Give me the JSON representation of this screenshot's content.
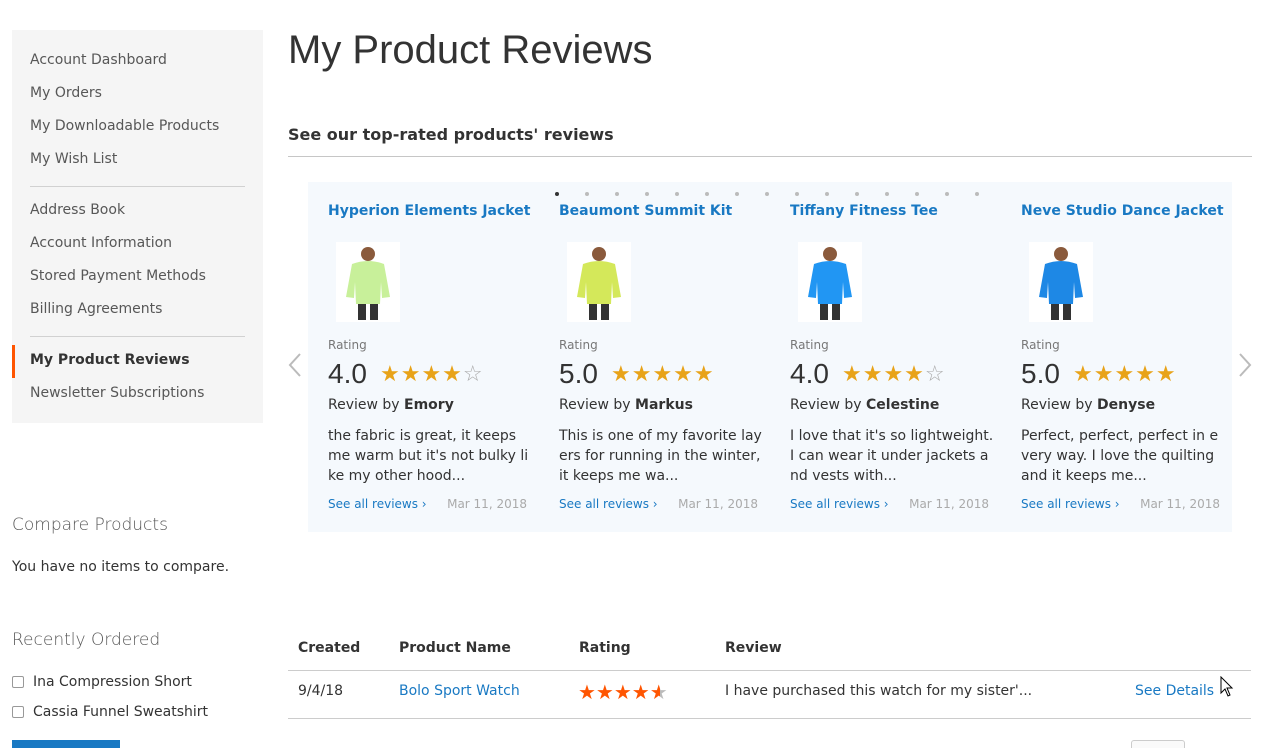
{
  "sidebar": {
    "group1": [
      "Account Dashboard",
      "My Orders",
      "My Downloadable Products",
      "My Wish List"
    ],
    "group2": [
      "Address Book",
      "Account Information",
      "Stored Payment Methods",
      "Billing Agreements"
    ],
    "group3": [
      "My Product Reviews",
      "Newsletter Subscriptions"
    ],
    "active": "My Product Reviews"
  },
  "compare": {
    "title": "Compare Products",
    "empty": "You have no items to compare."
  },
  "recently_ordered": {
    "title": "Recently Ordered",
    "items": [
      "Ina Compression Short",
      "Cassia Funnel Sweatshirt"
    ]
  },
  "page": {
    "title": "My Product Reviews"
  },
  "carousel": {
    "title": "See our top-rated products' reviews",
    "dots_count": 15,
    "active_dot": 0,
    "cards": [
      {
        "product": "Hyperion Elements Jacket",
        "rating_label": "Rating",
        "score": "4.0",
        "stars": 4,
        "by_prefix": "Review by",
        "author": "Emory",
        "text": "the fabric is great, it keeps me warm but it's not bulky like my other hood...",
        "see_all": "See all reviews ›",
        "date": "Mar 11, 2018",
        "shirt_color": "#c8f09a"
      },
      {
        "product": "Beaumont Summit Kit",
        "rating_label": "Rating",
        "score": "5.0",
        "stars": 5,
        "by_prefix": "Review by",
        "author": "Markus",
        "text": "This is one of my favorite layers for running in the winter, it keeps me wa...",
        "see_all": "See all reviews ›",
        "date": "Mar 11, 2018",
        "shirt_color": "#d4e85a"
      },
      {
        "product": "Tiffany Fitness Tee",
        "rating_label": "Rating",
        "score": "4.0",
        "stars": 4,
        "by_prefix": "Review by",
        "author": "Celestine",
        "text": "I love that it's so lightweight. I can wear it under jackets and vests with...",
        "see_all": "See all reviews ›",
        "date": "Mar 11, 2018",
        "shirt_color": "#2196f3"
      },
      {
        "product": "Neve Studio Dance Jacket",
        "rating_label": "Rating",
        "score": "5.0",
        "stars": 5,
        "by_prefix": "Review by",
        "author": "Denyse",
        "text": "Perfect, perfect, perfect in every way. I love the quilting and it keeps me...",
        "see_all": "See all reviews ›",
        "date": "Mar 11, 2018",
        "shirt_color": "#1e88e5"
      }
    ]
  },
  "table": {
    "headers": [
      "Created",
      "Product Name",
      "Rating",
      "Review"
    ],
    "rows": [
      {
        "created": "9/4/18",
        "product": "Bolo Sport Watch",
        "rating": 4.5,
        "review": "I have purchased this watch for my sister'...",
        "action": "See Details"
      }
    ]
  },
  "icons": [
    "chevron-left-icon",
    "chevron-right-icon",
    "star-icon",
    "cursor-icon"
  ],
  "colors": {
    "accent": "#ff5501",
    "link": "#1979c3",
    "star": "#e8a319"
  }
}
